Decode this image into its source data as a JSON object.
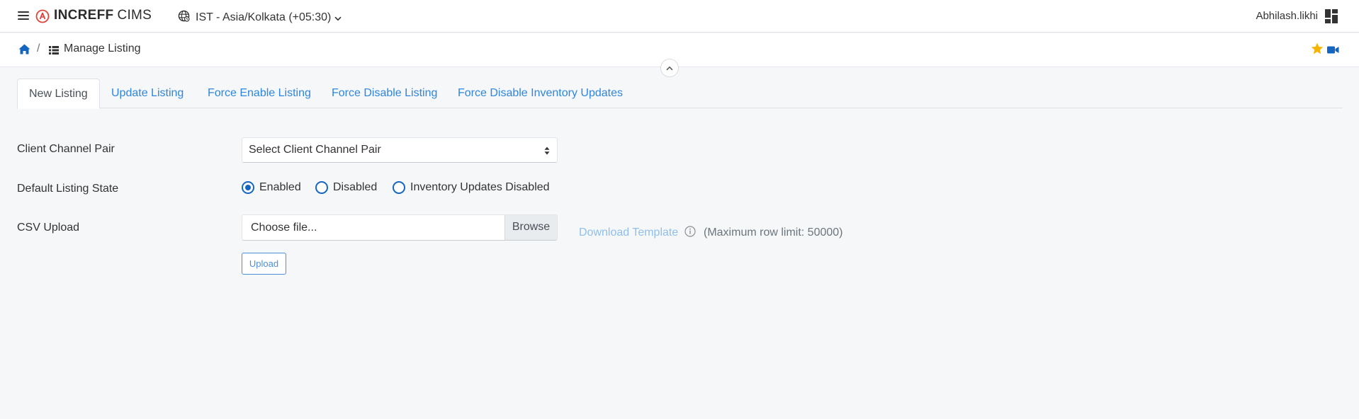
{
  "header": {
    "brand_bold": "INCREFF",
    "brand_light": "CIMS",
    "timezone": "IST - Asia/Kolkata (+05:30)",
    "user": "Abhilash.likhi"
  },
  "breadcrumb": {
    "separator": "/",
    "title": "Manage Listing"
  },
  "tabs": [
    {
      "label": "New Listing",
      "active": true
    },
    {
      "label": "Update Listing",
      "active": false
    },
    {
      "label": "Force Enable Listing",
      "active": false
    },
    {
      "label": "Force Disable Listing",
      "active": false
    },
    {
      "label": "Force Disable Inventory Updates",
      "active": false
    }
  ],
  "form": {
    "client_channel_label": "Client Channel Pair",
    "client_channel_value": "Select Client Channel Pair",
    "listing_state_label": "Default Listing State",
    "radios": [
      {
        "label": "Enabled",
        "checked": true
      },
      {
        "label": "Disabled",
        "checked": false
      },
      {
        "label": "Inventory Updates Disabled",
        "checked": false
      }
    ],
    "csv_label": "CSV Upload",
    "file_placeholder": "Choose file...",
    "browse_label": "Browse",
    "download_template": "Download Template",
    "row_limit": "(Maximum row limit: 50000)",
    "upload_label": "Upload"
  },
  "colors": {
    "primary_link": "#2e86de",
    "radio_accent": "#1565c0",
    "star": "#f5b400",
    "logo_red": "#e0433a"
  }
}
